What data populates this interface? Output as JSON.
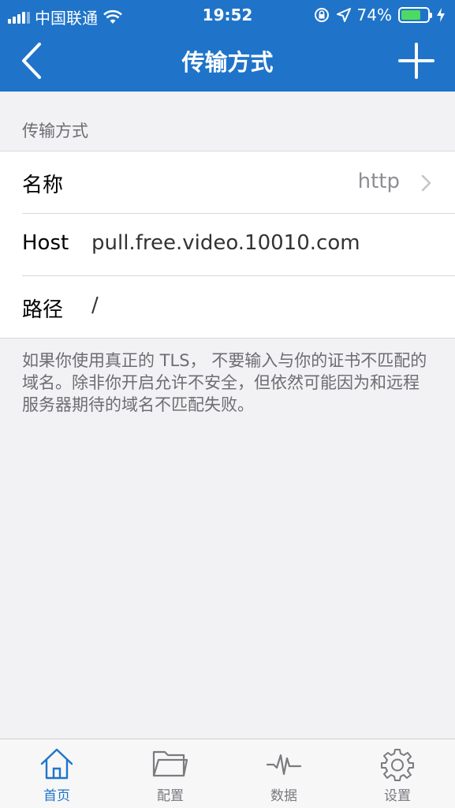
{
  "status_bar": {
    "carrier": "中国联通",
    "time": "19:52",
    "battery_percent": "74%",
    "battery_level": 0.74,
    "icons": [
      "signal-icon",
      "wifi-icon",
      "rotation-lock-icon",
      "location-icon",
      "battery-icon",
      "charging-icon"
    ]
  },
  "nav": {
    "title": "传输方式",
    "back_icon": "chevron-left-icon",
    "add_icon": "plus-icon"
  },
  "section": {
    "header": "传输方式",
    "rows": [
      {
        "label": "名称",
        "value": "http",
        "has_chevron": true
      },
      {
        "label": "Host",
        "value": "pull.free.video.10010.com"
      },
      {
        "label": "路径",
        "value": "/"
      }
    ],
    "footer": "如果你使用真正的 TLS， 不要输入与你的证书不匹配的域名。除非你开启允许不安全，但依然可能因为和远程服务器期待的域名不匹配失败。"
  },
  "tabs": [
    {
      "label": "首页",
      "icon": "home-icon",
      "active": true
    },
    {
      "label": "配置",
      "icon": "folder-icon",
      "active": false
    },
    {
      "label": "数据",
      "icon": "waveform-icon",
      "active": false
    },
    {
      "label": "设置",
      "icon": "gear-icon",
      "active": false
    }
  ],
  "colors": {
    "accent": "#1f74c9",
    "background": "#f2f2f4",
    "battery_fill": "#4cd964"
  }
}
